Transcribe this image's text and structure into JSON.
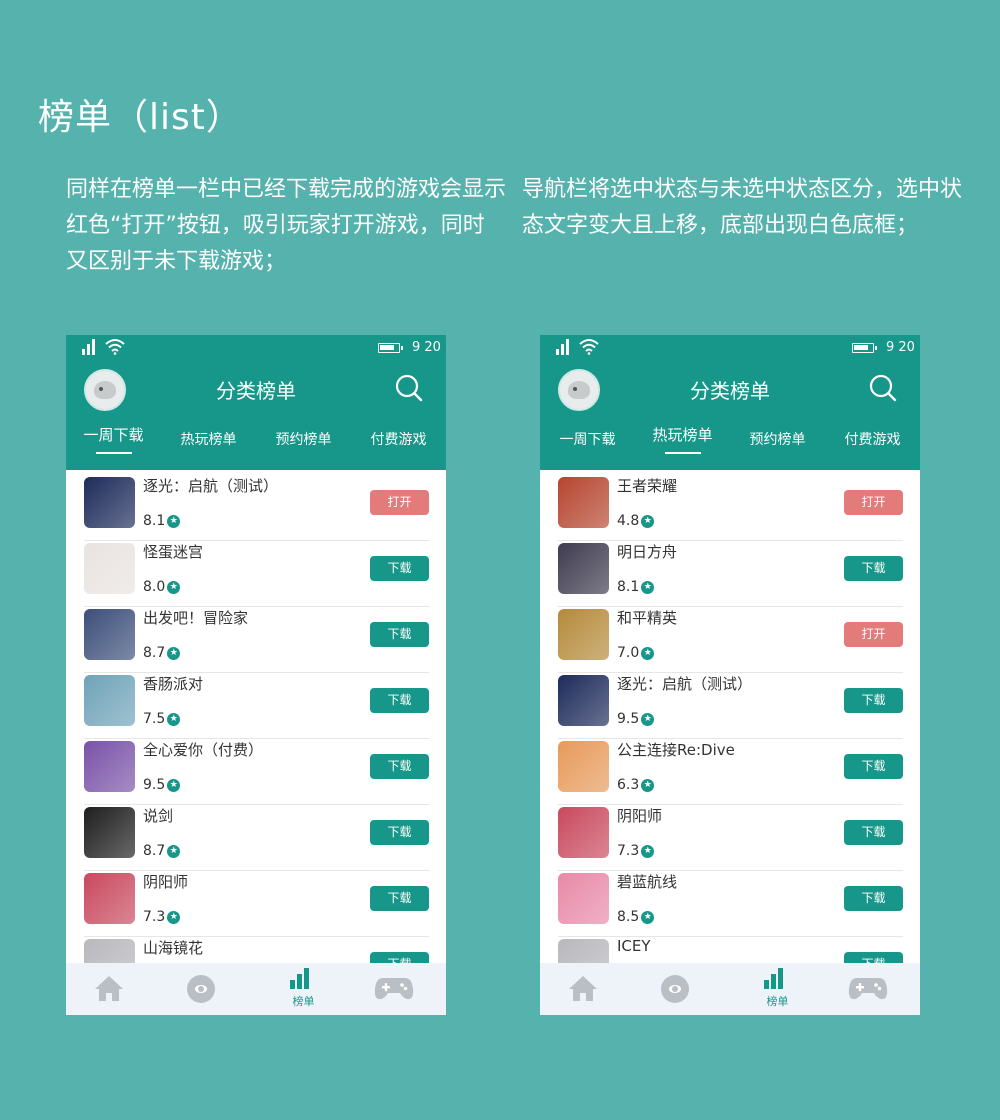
{
  "page": {
    "title": "榜单（list）",
    "desc_left": "同样在榜单一栏中已经下载完成的游戏会显示红色“打开”按钮，吸引玩家打开游戏，同时又区别于未下载游戏；",
    "desc_right": "导航栏将选中状态与未选中状态区分，选中状态文字变大且上移，底部出现白色底框；"
  },
  "phone1": {
    "time": "9 20",
    "header_title": "分类榜单",
    "tabs": [
      "一周下载",
      "热玩榜单",
      "预约榜单",
      "付费游戏"
    ],
    "active_tab": 0,
    "games": [
      {
        "name": "逐光：启航（测试）",
        "rating": "8.1",
        "button": "打开",
        "state": "open",
        "color": "#1d2b5a"
      },
      {
        "name": "怪蛋迷宫",
        "rating": "8.0",
        "button": "下载",
        "state": "download",
        "color": "#e9e3e0"
      },
      {
        "name": "出发吧！冒险家",
        "rating": "8.7",
        "button": "下载",
        "state": "download",
        "color": "#3c4f7a"
      },
      {
        "name": "香肠派对",
        "rating": "7.5",
        "button": "下载",
        "state": "download",
        "color": "#6fa3b8"
      },
      {
        "name": "全心爱你（付费）",
        "rating": "9.5",
        "button": "下载",
        "state": "download",
        "color": "#7a52a8"
      },
      {
        "name": "说剑",
        "rating": "8.7",
        "button": "下载",
        "state": "download",
        "color": "#1e1e1e"
      },
      {
        "name": "阴阳师",
        "rating": "7.3",
        "button": "下载",
        "state": "download",
        "color": "#c9495e"
      },
      {
        "name": "山海镜花",
        "rating": "",
        "button": "下载",
        "state": "download",
        "color": "#b8b8bd"
      }
    ],
    "nav": {
      "label": "榜单"
    }
  },
  "phone2": {
    "time": "9 20",
    "header_title": "分类榜单",
    "tabs": [
      "一周下载",
      "热玩榜单",
      "预约榜单",
      "付费游戏"
    ],
    "active_tab": 1,
    "games": [
      {
        "name": "王者荣耀",
        "rating": "4.8",
        "button": "打开",
        "state": "open",
        "color": "#b6452f"
      },
      {
        "name": "明日方舟",
        "rating": "8.1",
        "button": "下载",
        "state": "download",
        "color": "#3e3b4f"
      },
      {
        "name": "和平精英",
        "rating": "7.0",
        "button": "打开",
        "state": "open",
        "color": "#b48a3a"
      },
      {
        "name": "逐光：启航（测试）",
        "rating": "9.5",
        "button": "下载",
        "state": "download",
        "color": "#1d2b5a"
      },
      {
        "name": "公主连接Re:Dive",
        "rating": "6.3",
        "button": "下载",
        "state": "download",
        "color": "#e79a5a"
      },
      {
        "name": "阴阳师",
        "rating": "7.3",
        "button": "下载",
        "state": "download",
        "color": "#c9495e"
      },
      {
        "name": "碧蓝航线",
        "rating": "8.5",
        "button": "下载",
        "state": "download",
        "color": "#e889a8"
      },
      {
        "name": "ICEY",
        "rating": "",
        "button": "下载",
        "state": "download",
        "color": "#b8b8bd"
      }
    ],
    "nav": {
      "label": "榜单"
    }
  }
}
